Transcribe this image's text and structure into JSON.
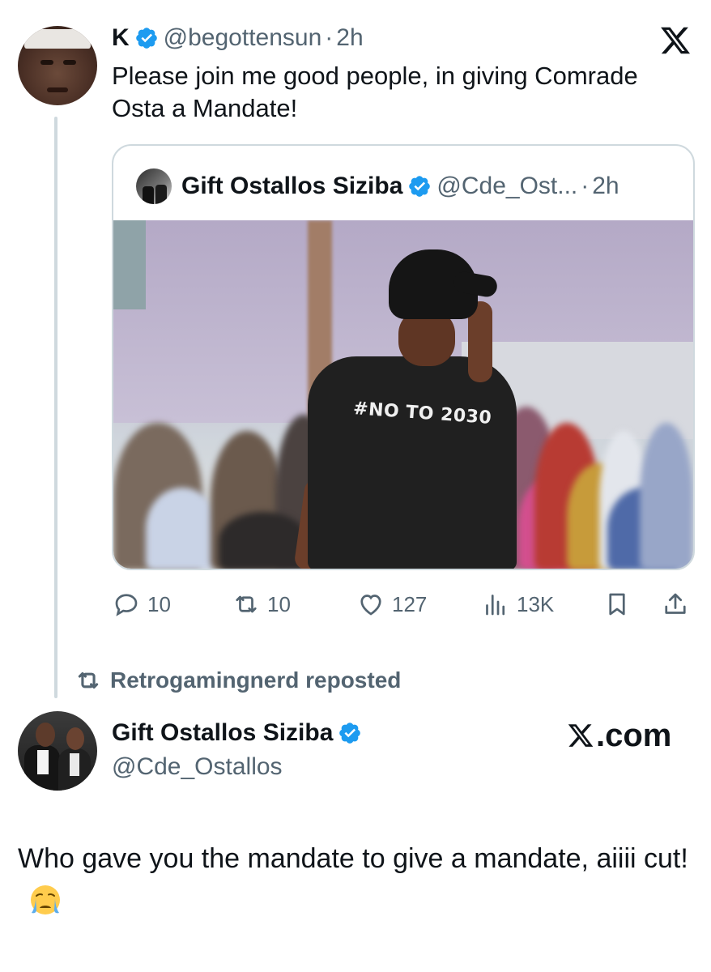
{
  "tweet1": {
    "name": "K",
    "handle": "@begottensun",
    "separator": "·",
    "time": "2h",
    "text": "Please join me good people, in  giving Comrade Osta a Mandate!",
    "icons": {
      "avatar": "user-avatar",
      "verified": "verified-badge-icon",
      "platform": "x-logo-icon"
    }
  },
  "quote": {
    "name": "Gift Ostallos Siziba",
    "handle": "@Cde_Ost...",
    "separator": "·",
    "time": "2h",
    "photo_shirt_text": "#NO TO 2030"
  },
  "actions": {
    "replies": "10",
    "reposts": "10",
    "likes": "127",
    "views": "13K",
    "icons": [
      "reply-icon",
      "repost-icon",
      "like-icon",
      "views-icon",
      "bookmark-icon",
      "share-icon"
    ]
  },
  "repost_line": {
    "text": "Retrogamingnerd reposted"
  },
  "tweet2": {
    "name": "Gift Ostallos Siziba",
    "handle": "@Cde_Ostallos",
    "watermark": ".com",
    "text": "Who gave you the mandate to give a mandate, aiiii cut!",
    "emoji": "loudly-crying-face"
  },
  "colors": {
    "text_primary": "#0f1419",
    "text_secondary": "#536471",
    "verified_blue": "#1d9bf0",
    "border": "#cfd9de"
  }
}
